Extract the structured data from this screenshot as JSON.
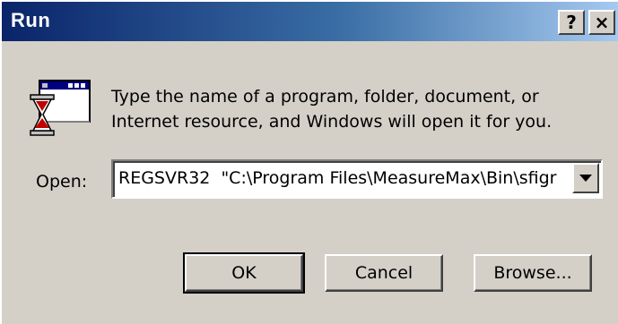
{
  "window": {
    "title": "Run",
    "help_label": "?",
    "close_label": "×"
  },
  "description": "Type the name of a program, folder, document, or Internet resource, and Windows will open it for you.",
  "open": {
    "label": "Open:",
    "value": "REGSVR32  \"C:\\Program Files\\MeasureMax\\Bin\\sfigr"
  },
  "buttons": {
    "ok": "OK",
    "cancel": "Cancel",
    "browse": "Browse..."
  },
  "icons": {
    "run": "run-program-hourglass-icon",
    "dropdown": "chevron-down-icon"
  },
  "colors": {
    "titlebar_start": "#0a246a",
    "titlebar_end": "#a6caf0",
    "dialog_face": "#d4d0c8"
  }
}
